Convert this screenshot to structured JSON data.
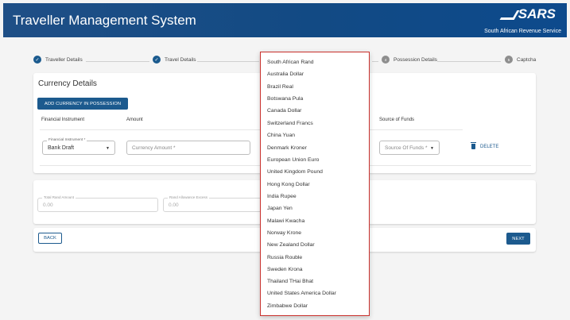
{
  "header": {
    "title": "Traveller Management System",
    "logo_text": "SARS",
    "tagline": "South African Revenue Service"
  },
  "stepper": {
    "steps": [
      {
        "label": "Traveller Details",
        "state": "complete",
        "marker": "✓"
      },
      {
        "label": "Travel Details",
        "state": "complete",
        "marker": "✓"
      },
      {
        "label": "Possession Details",
        "state": "pending",
        "marker": "4"
      },
      {
        "label": "Captcha",
        "state": "pending",
        "marker": "5"
      }
    ]
  },
  "currency": {
    "title": "Currency Details",
    "add_button": "ADD CURRENCY IN POSSESSION",
    "columns": {
      "instrument": "Financial Instrument",
      "amount": "Amount",
      "source": "Source of Funds"
    },
    "row": {
      "instrument_label": "Financial Instrument *",
      "instrument_value": "Bank Draft",
      "amount_placeholder": "Currency Amount *",
      "source_placeholder": "Source Of Funds *",
      "delete_label": "DELETE"
    }
  },
  "totals": {
    "total_label": "Total Rand Amount",
    "total_value": "0.00",
    "allowance_label": "Rand Allowance Excess",
    "allowance_value": "0.00"
  },
  "nav": {
    "back": "BACK",
    "next": "NEXT"
  },
  "dropdown": {
    "options": [
      "South African Rand",
      "Australia Dollar",
      "Brazil Real",
      "Botswana Pula",
      "Canada Dollar",
      "Switzerland Francs",
      "China Yuan",
      "Denmark Kroner",
      "European Union Euro",
      "United Kingdom Pound",
      "Hong Kong Dollar",
      "India Rupee",
      "Japan Yen",
      "Malawi Kwacha",
      "Norway Krone",
      "New Zealand Dollar",
      "Russia Rouble",
      "Sweden Krona",
      "Thailand THai Bhat",
      "United States America Dollar",
      "Zimbabwe Dollar"
    ]
  },
  "colors": {
    "primary": "#1c5a8e",
    "header": "#124a84",
    "dropdown_border": "#c9302c"
  },
  "icons": [
    "check-icon",
    "trash-icon",
    "chevron-down-icon",
    "sars-logo-icon"
  ]
}
